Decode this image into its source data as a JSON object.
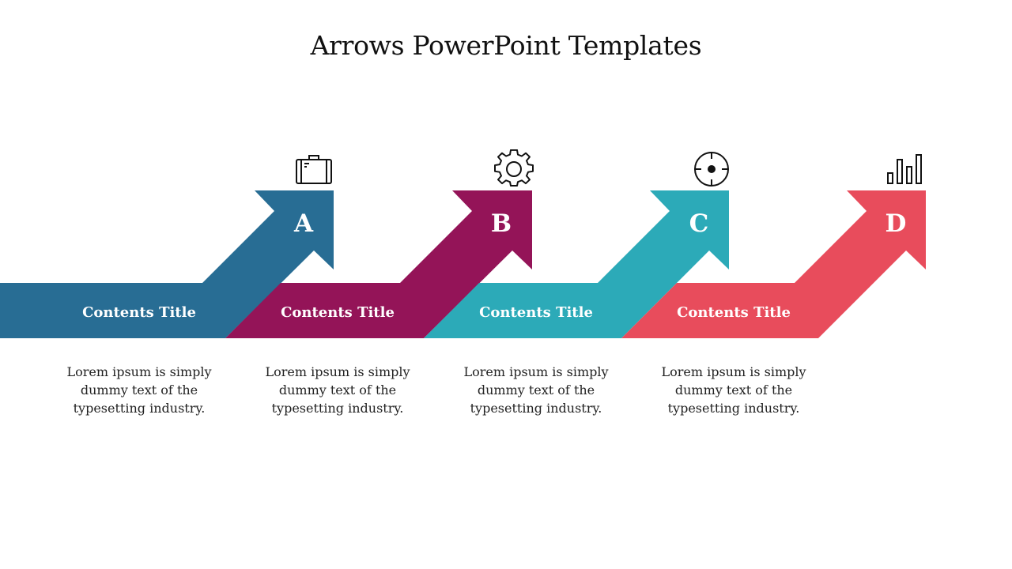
{
  "slide": {
    "title": "Arrows PowerPoint Templates",
    "steps": [
      {
        "letter": "A",
        "heading": "Contents Title",
        "text": "Lorem ipsum is simply dummy text of the typesetting industry.",
        "icon": "briefcase-icon",
        "color": "#286d94"
      },
      {
        "letter": "B",
        "heading": "Contents Title",
        "text": "Lorem ipsum is simply dummy text of the typesetting industry.",
        "icon": "gear-icon",
        "color": "#941458"
      },
      {
        "letter": "C",
        "heading": "Contents Title",
        "text": "Lorem ipsum is simply dummy text of the typesetting industry.",
        "icon": "target-icon",
        "color": "#2caab8"
      },
      {
        "letter": "D",
        "heading": "Contents Title",
        "text": "Lorem ipsum is simply dummy text of the typesetting industry.",
        "icon": "bar-chart-icon",
        "color": "#e84c5c"
      }
    ]
  }
}
